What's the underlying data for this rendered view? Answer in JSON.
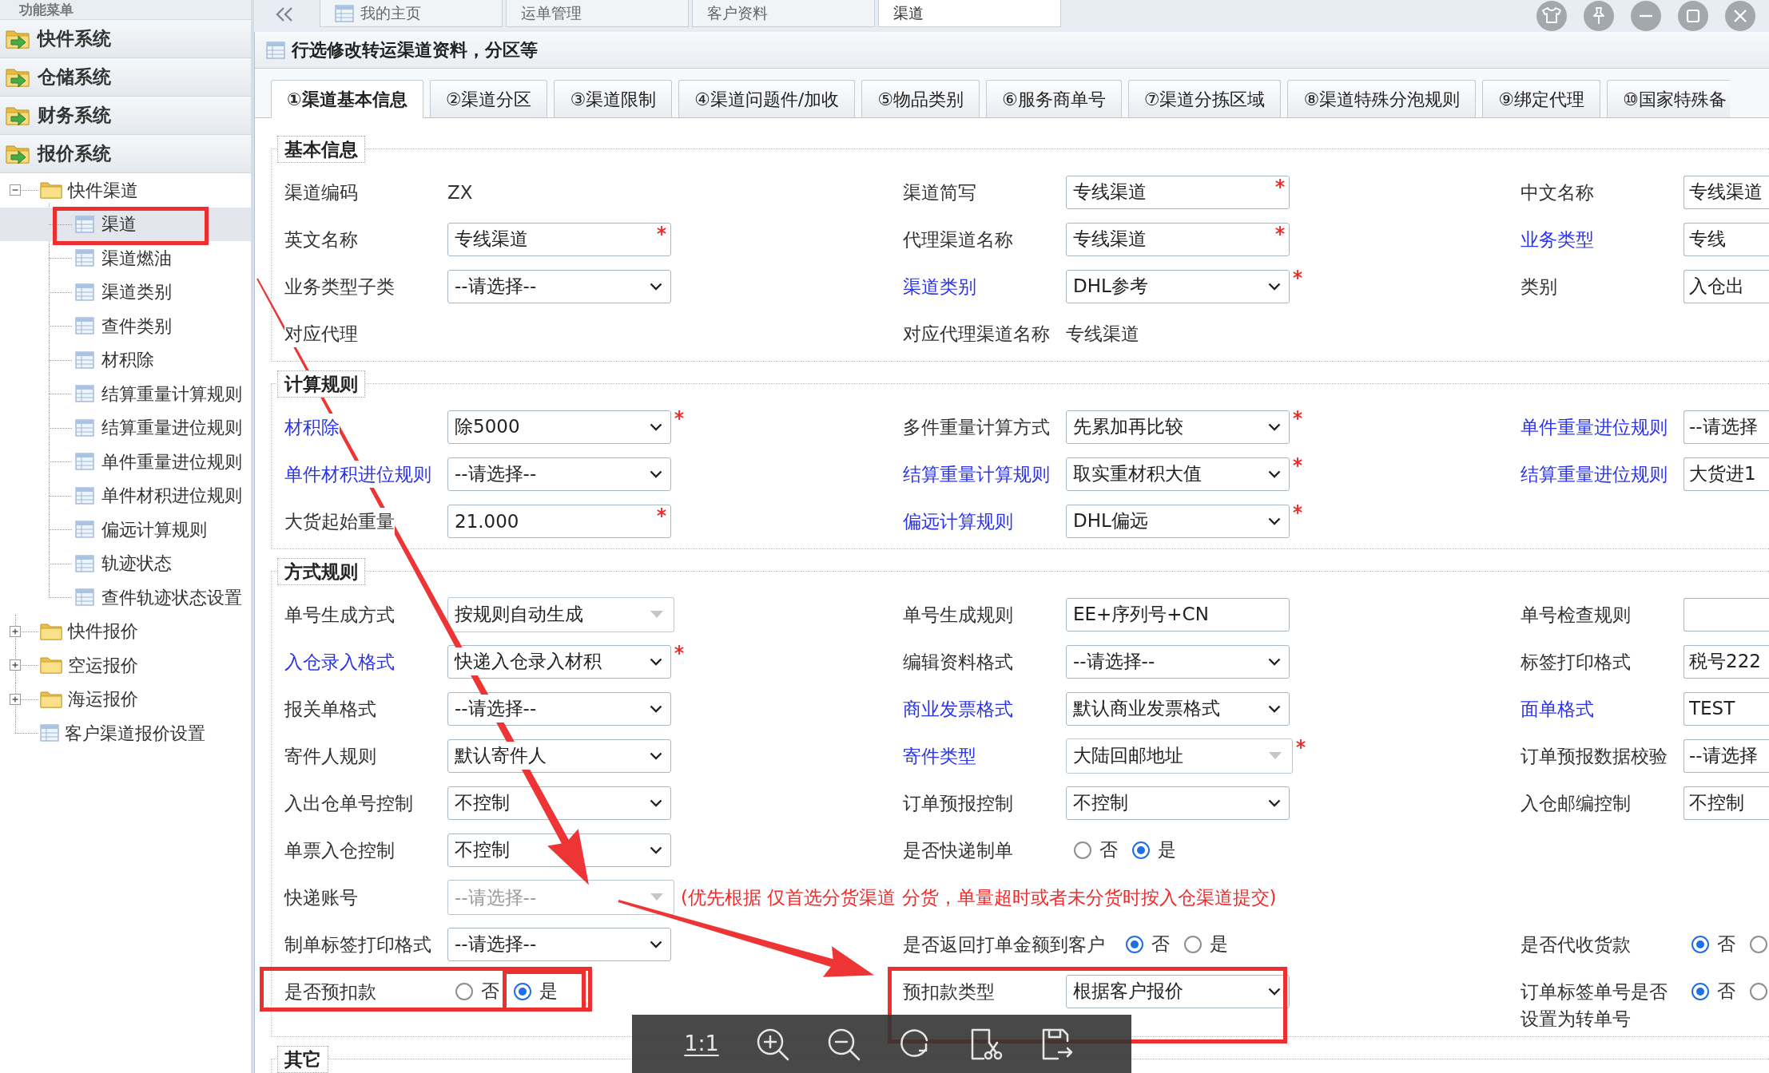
{
  "sidebar": {
    "title": "功能菜单",
    "sections": [
      {
        "label": "快件系统"
      },
      {
        "label": "仓储系统"
      },
      {
        "label": "财务系统"
      },
      {
        "label": "报价系统",
        "tree": [
          {
            "label": "快件渠道",
            "kind": "folder",
            "expanded": true,
            "selected": false,
            "highlighted": false,
            "children": [
              {
                "label": "渠道",
                "kind": "page",
                "selected": true,
                "highlighted": true
              },
              {
                "label": "渠道燃油",
                "kind": "page",
                "selected": false,
                "highlighted": false
              },
              {
                "label": "渠道类别",
                "kind": "page",
                "selected": false,
                "highlighted": false
              },
              {
                "label": "查件类别",
                "kind": "page",
                "selected": false,
                "highlighted": false
              },
              {
                "label": "材积除",
                "kind": "page",
                "selected": false,
                "highlighted": false
              },
              {
                "label": "结算重量计算规则",
                "kind": "page",
                "selected": false,
                "highlighted": false
              },
              {
                "label": "结算重量进位规则",
                "kind": "page",
                "selected": false,
                "highlighted": false
              },
              {
                "label": "单件重量进位规则",
                "kind": "page",
                "selected": false,
                "highlighted": false
              },
              {
                "label": "单件材积进位规则",
                "kind": "page",
                "selected": false,
                "highlighted": false
              },
              {
                "label": "偏远计算规则",
                "kind": "page",
                "selected": false,
                "highlighted": false
              },
              {
                "label": "轨迹状态",
                "kind": "page",
                "selected": false,
                "highlighted": false
              },
              {
                "label": "查件轨迹状态设置",
                "kind": "page",
                "selected": false,
                "highlighted": false
              }
            ]
          },
          {
            "label": "快件报价",
            "kind": "folder",
            "expanded": false,
            "selected": false,
            "highlighted": false
          },
          {
            "label": "空运报价",
            "kind": "folder",
            "expanded": false,
            "selected": false,
            "highlighted": false
          },
          {
            "label": "海运报价",
            "kind": "folder",
            "expanded": false,
            "selected": false,
            "highlighted": false
          },
          {
            "label": "客户渠道报价设置",
            "kind": "page",
            "selected": false,
            "highlighted": false
          }
        ]
      }
    ]
  },
  "top_tabs": [
    {
      "label": "我的主页",
      "kind": "home",
      "selected": false
    },
    {
      "label": "运单管理",
      "kind": "page",
      "selected": false
    },
    {
      "label": "客户资料",
      "kind": "page",
      "selected": false
    },
    {
      "label": "渠道",
      "kind": "page",
      "selected": true
    }
  ],
  "panel": {
    "title": "行选修改转运渠道资料，分区等"
  },
  "tabs": [
    {
      "label": "①渠道基本信息",
      "selected": true
    },
    {
      "label": "②渠道分区",
      "selected": false
    },
    {
      "label": "③渠道限制",
      "selected": false
    },
    {
      "label": "④渠道问题件/加收",
      "selected": false
    },
    {
      "label": "⑤物品类别",
      "selected": false
    },
    {
      "label": "⑥服务商单号",
      "selected": false
    },
    {
      "label": "⑦渠道分拣区域",
      "selected": false
    },
    {
      "label": "⑧渠道特殊分泡规则",
      "selected": false
    },
    {
      "label": "⑨绑定代理",
      "selected": false
    },
    {
      "label": "⑩国家特殊备",
      "selected": false
    }
  ],
  "form": {
    "sections": [
      {
        "legend": "基本信息",
        "rows": [
          [
            {
              "label": "渠道编码",
              "link": false,
              "kind": "text",
              "value": "ZX",
              "required": false,
              "highlighted": false
            },
            {
              "label": "渠道简写",
              "link": false,
              "kind": "input",
              "value": "专线渠道",
              "required": true,
              "highlighted": false
            },
            {
              "label": "中文名称",
              "link": false,
              "kind": "input",
              "value": "专线渠道",
              "required": false,
              "highlighted": false
            }
          ],
          [
            {
              "label": "英文名称",
              "link": false,
              "kind": "input",
              "value": "专线渠道",
              "required": true,
              "highlighted": false
            },
            {
              "label": "代理渠道名称",
              "link": false,
              "kind": "input",
              "value": "专线渠道",
              "required": true,
              "highlighted": false
            },
            {
              "label": "业务类型",
              "link": true,
              "kind": "select",
              "value": "专线",
              "required": false,
              "highlighted": false
            }
          ],
          [
            {
              "label": "业务类型子类",
              "link": false,
              "kind": "select",
              "value": "--请选择--",
              "required": false,
              "highlighted": false
            },
            {
              "label": "渠道类别",
              "link": true,
              "kind": "select",
              "value": "DHL参考",
              "required": true,
              "highlighted": false
            },
            {
              "label": "类别",
              "link": false,
              "kind": "select",
              "value": "入仓出",
              "required": false,
              "highlighted": false
            }
          ],
          [
            {
              "label": "对应代理",
              "link": false,
              "kind": "text",
              "required": false,
              "highlighted": false
            },
            {
              "label": "对应代理渠道名称",
              "link": false,
              "kind": "text",
              "value": "专线渠道",
              "required": false,
              "highlighted": false
            }
          ]
        ]
      },
      {
        "legend": "计算规则",
        "rows": [
          [
            {
              "label": "材积除",
              "link": true,
              "kind": "select",
              "value": "除5000",
              "required": true,
              "highlighted": false
            },
            {
              "label": "多件重量计算方式",
              "link": false,
              "kind": "select",
              "value": "先累加再比较",
              "required": true,
              "highlighted": false
            },
            {
              "label": "单件重量进位规则",
              "link": true,
              "kind": "select",
              "value": "--请选择",
              "required": false,
              "highlighted": false
            }
          ],
          [
            {
              "label": "单件材积进位规则",
              "link": true,
              "kind": "select",
              "value": "--请选择--",
              "required": false,
              "highlighted": false
            },
            {
              "label": "结算重量计算规则",
              "link": true,
              "kind": "select",
              "value": "取实重材积大值",
              "required": true,
              "highlighted": false
            },
            {
              "label": "结算重量进位规则",
              "link": true,
              "kind": "select",
              "value": "大货进1",
              "required": false,
              "highlighted": false
            }
          ],
          [
            {
              "label": "大货起始重量",
              "link": false,
              "kind": "input",
              "value": "21.000",
              "required": true,
              "highlighted": false
            },
            {
              "label": "偏远计算规则",
              "link": true,
              "kind": "select",
              "value": "DHL偏远",
              "required": true,
              "highlighted": false
            }
          ]
        ]
      },
      {
        "legend": "方式规则",
        "rows": [
          [
            {
              "label": "单号生成方式",
              "link": false,
              "kind": "combo",
              "value": "按规则自动生成",
              "required": false,
              "highlighted": false
            },
            {
              "label": "单号生成规则",
              "link": false,
              "kind": "input",
              "value": "EE+序列号+CN",
              "required": false,
              "highlighted": false
            },
            {
              "label": "单号检查规则",
              "link": false,
              "kind": "input",
              "required": false,
              "highlighted": false
            }
          ],
          [
            {
              "label": "入仓录入格式",
              "link": true,
              "kind": "select",
              "value": "快递入仓录入材积",
              "required": true,
              "highlighted": false
            },
            {
              "label": "编辑资料格式",
              "link": false,
              "kind": "select",
              "value": "--请选择--",
              "required": false,
              "highlighted": false
            },
            {
              "label": "标签打印格式",
              "link": false,
              "kind": "select",
              "value": "税号222",
              "required": false,
              "highlighted": false
            }
          ],
          [
            {
              "label": "报关单格式",
              "link": false,
              "kind": "select",
              "value": "--请选择--",
              "required": false,
              "highlighted": false
            },
            {
              "label": "商业发票格式",
              "link": true,
              "kind": "select",
              "value": "默认商业发票格式",
              "required": false,
              "highlighted": false
            },
            {
              "label": "面单格式",
              "link": true,
              "kind": "select",
              "value": "TEST",
              "required": false,
              "highlighted": false
            }
          ],
          [
            {
              "label": "寄件人规则",
              "link": false,
              "kind": "select",
              "value": "默认寄件人",
              "required": false,
              "highlighted": false
            },
            {
              "label": "寄件类型",
              "link": true,
              "kind": "combo",
              "value": "大陆回邮地址",
              "required": true,
              "highlighted": false
            },
            {
              "label": "订单预报数据校验",
              "link": false,
              "kind": "select",
              "value": "--请选择",
              "required": false,
              "highlighted": false
            }
          ],
          [
            {
              "label": "入出仓单号控制",
              "link": false,
              "kind": "select",
              "value": "不控制",
              "required": false,
              "highlighted": false
            },
            {
              "label": "订单预报控制",
              "link": false,
              "kind": "select",
              "value": "不控制",
              "required": false,
              "highlighted": false
            },
            {
              "label": "入仓邮编控制",
              "link": false,
              "kind": "select",
              "value": "不控制",
              "required": false,
              "highlighted": false
            }
          ],
          [
            {
              "label": "单票入仓控制",
              "link": false,
              "kind": "select",
              "value": "不控制",
              "required": false,
              "highlighted": false
            },
            {
              "label": "是否快递制单",
              "link": false,
              "kind": "radio",
              "required": false,
              "highlighted": false,
              "options": [
                {
                  "label": "否",
                  "selected": false,
                  "highlighted": false
                },
                {
                  "label": "是",
                  "selected": true,
                  "highlighted": false
                }
              ]
            }
          ],
          [
            {
              "label": "快递账号",
              "link": false,
              "kind": "combo",
              "placeholder": "--请选择--",
              "required": false,
              "highlighted": false,
              "note": "(优先根据 仅首选分货渠道 分货，单量超时或者未分货时按入仓渠道提交)"
            }
          ],
          [
            {
              "label": "制单标签打印格式",
              "link": false,
              "kind": "select",
              "value": "--请选择--",
              "required": false,
              "highlighted": false
            },
            {
              "label": "是否返回打单金额到客户",
              "link": false,
              "kind": "radio",
              "required": false,
              "highlighted": false,
              "options": [
                {
                  "label": "否",
                  "selected": true,
                  "highlighted": false
                },
                {
                  "label": "是",
                  "selected": false,
                  "highlighted": false
                }
              ]
            },
            {
              "label": "是否代收货款",
              "link": false,
              "kind": "radio",
              "required": false,
              "highlighted": false,
              "options": [
                {
                  "label": "否",
                  "selected": true,
                  "highlighted": false
                },
                {
                  "selected": false,
                  "highlighted": false
                }
              ]
            }
          ],
          [
            {
              "label": "是否预扣款",
              "link": false,
              "kind": "radio",
              "required": false,
              "highlighted": true,
              "options": [
                {
                  "label": "否",
                  "selected": false,
                  "highlighted": false
                },
                {
                  "label": "是",
                  "selected": true,
                  "highlighted": true
                }
              ]
            },
            {
              "label": "预扣款类型",
              "link": false,
              "kind": "select",
              "value": "根据客户报价",
              "required": false,
              "highlighted": true
            },
            {
              "label": "订单标签单号是否设置为转单号",
              "link": false,
              "kind": "radio",
              "required": false,
              "highlighted": false,
              "options": [
                {
                  "label": "否",
                  "selected": true,
                  "highlighted": false
                },
                {
                  "selected": false,
                  "highlighted": false
                }
              ]
            }
          ]
        ]
      },
      {
        "legend": "其它"
      }
    ]
  },
  "viewer_toolbar": {
    "actual_size": "1:1"
  }
}
